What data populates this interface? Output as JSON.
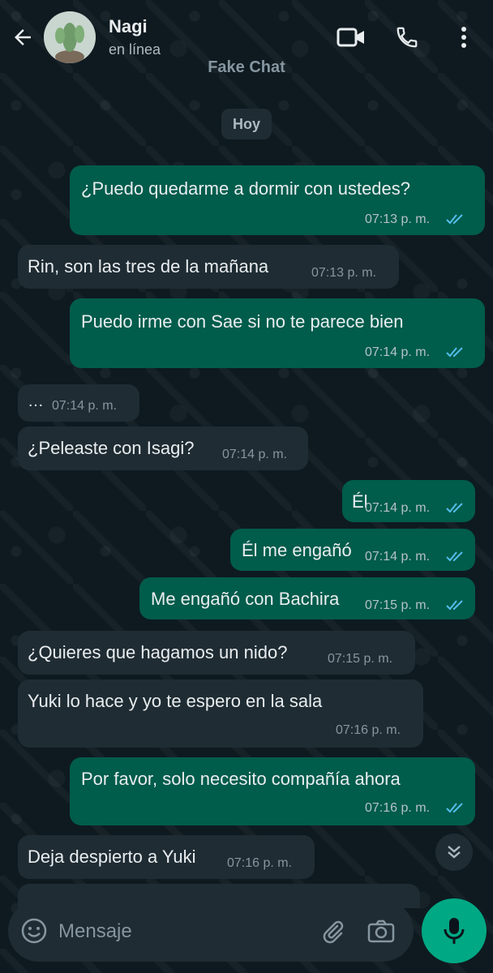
{
  "header": {
    "contact_name": "Nagi",
    "status": "en línea",
    "watermark": "Fake Chat",
    "icons": [
      "back-arrow-icon",
      "video-call-icon",
      "phone-icon",
      "more-vert-icon"
    ]
  },
  "date_chip": "Hoy",
  "messages": [
    {
      "dir": "out",
      "text": "¿Puedo quedarme a dormir con ustedes?",
      "time": "07:13 p. m.",
      "read": true
    },
    {
      "dir": "in",
      "text": "Rin, son las tres de la mañana",
      "time": "07:13 p. m."
    },
    {
      "dir": "out",
      "text": "Puedo irme con Sae si no te parece bien",
      "time": "07:14 p. m.",
      "read": true
    },
    {
      "dir": "in",
      "text": "…",
      "time": "07:14 p. m."
    },
    {
      "dir": "in",
      "text": "¿Peleaste con Isagi?",
      "time": "07:14 p. m."
    },
    {
      "dir": "out",
      "text": "Él",
      "time": "07:14 p. m.",
      "read": true
    },
    {
      "dir": "out",
      "text": "Él me engañó",
      "time": "07:14 p. m.",
      "read": true
    },
    {
      "dir": "out",
      "text": "Me engañó con Bachira",
      "time": "07:15 p. m.",
      "read": true
    },
    {
      "dir": "in",
      "text": "¿Quieres que hagamos un nido?",
      "time": "07:15 p. m."
    },
    {
      "dir": "in",
      "text": "Yuki lo hace y yo te espero en la sala",
      "time": "07:16 p. m."
    },
    {
      "dir": "out",
      "text": "Por favor, solo necesito compañía ahora",
      "time": "07:16 p. m.",
      "read": true
    },
    {
      "dir": "in",
      "text": "Deja despierto a Yuki",
      "time": "07:16 p. m."
    }
  ],
  "composer": {
    "placeholder": "Mensaje",
    "icons": [
      "emoji-icon",
      "attach-icon",
      "camera-icon",
      "mic-icon"
    ]
  },
  "colors": {
    "outgoing_bubble": "#005c4b",
    "incoming_bubble": "#1f2c33",
    "read_ticks": "#53bdeb",
    "accent": "#00a884"
  }
}
